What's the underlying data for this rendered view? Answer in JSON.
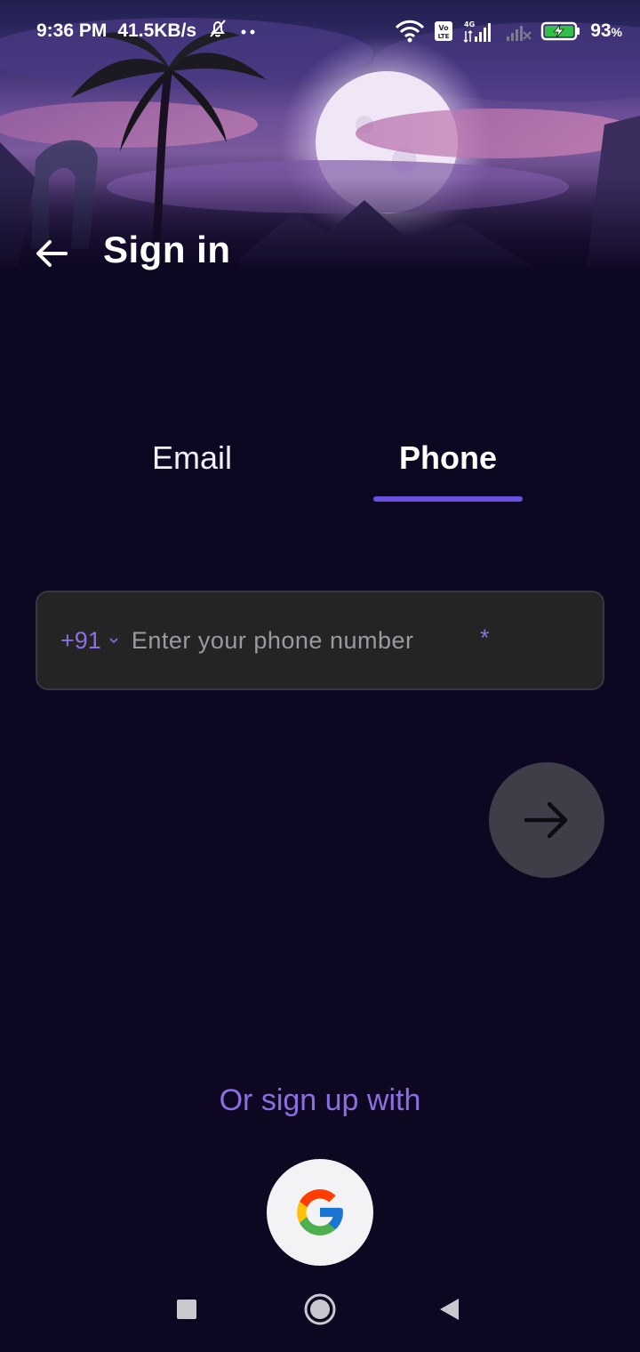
{
  "status_bar": {
    "time": "9:36 PM",
    "speed": "41.5KB/s",
    "battery_percent": "93",
    "battery_unit": "%",
    "network_label": "4G",
    "volte_label_top": "Vo",
    "volte_label_bottom": "LTE"
  },
  "header": {
    "title": "Sign in"
  },
  "tabs": [
    {
      "label": "Email",
      "selected": false
    },
    {
      "label": "Phone",
      "selected": true
    }
  ],
  "phone_field": {
    "country_code": "+91",
    "placeholder": "Enter your phone number",
    "required_mark": "*",
    "value": ""
  },
  "social": {
    "or_text": "Or sign up with"
  },
  "colors": {
    "background": "#0e0722",
    "accent": "#6a4fe0",
    "accent_text": "#8d6ee0",
    "field_bg": "#242424",
    "next_button_bg": "#3f3d48"
  },
  "icons": {
    "back": "arrow-left-icon",
    "next": "arrow-right-icon",
    "google": "google-logo-icon",
    "dropdown": "chevron-down-icon"
  }
}
